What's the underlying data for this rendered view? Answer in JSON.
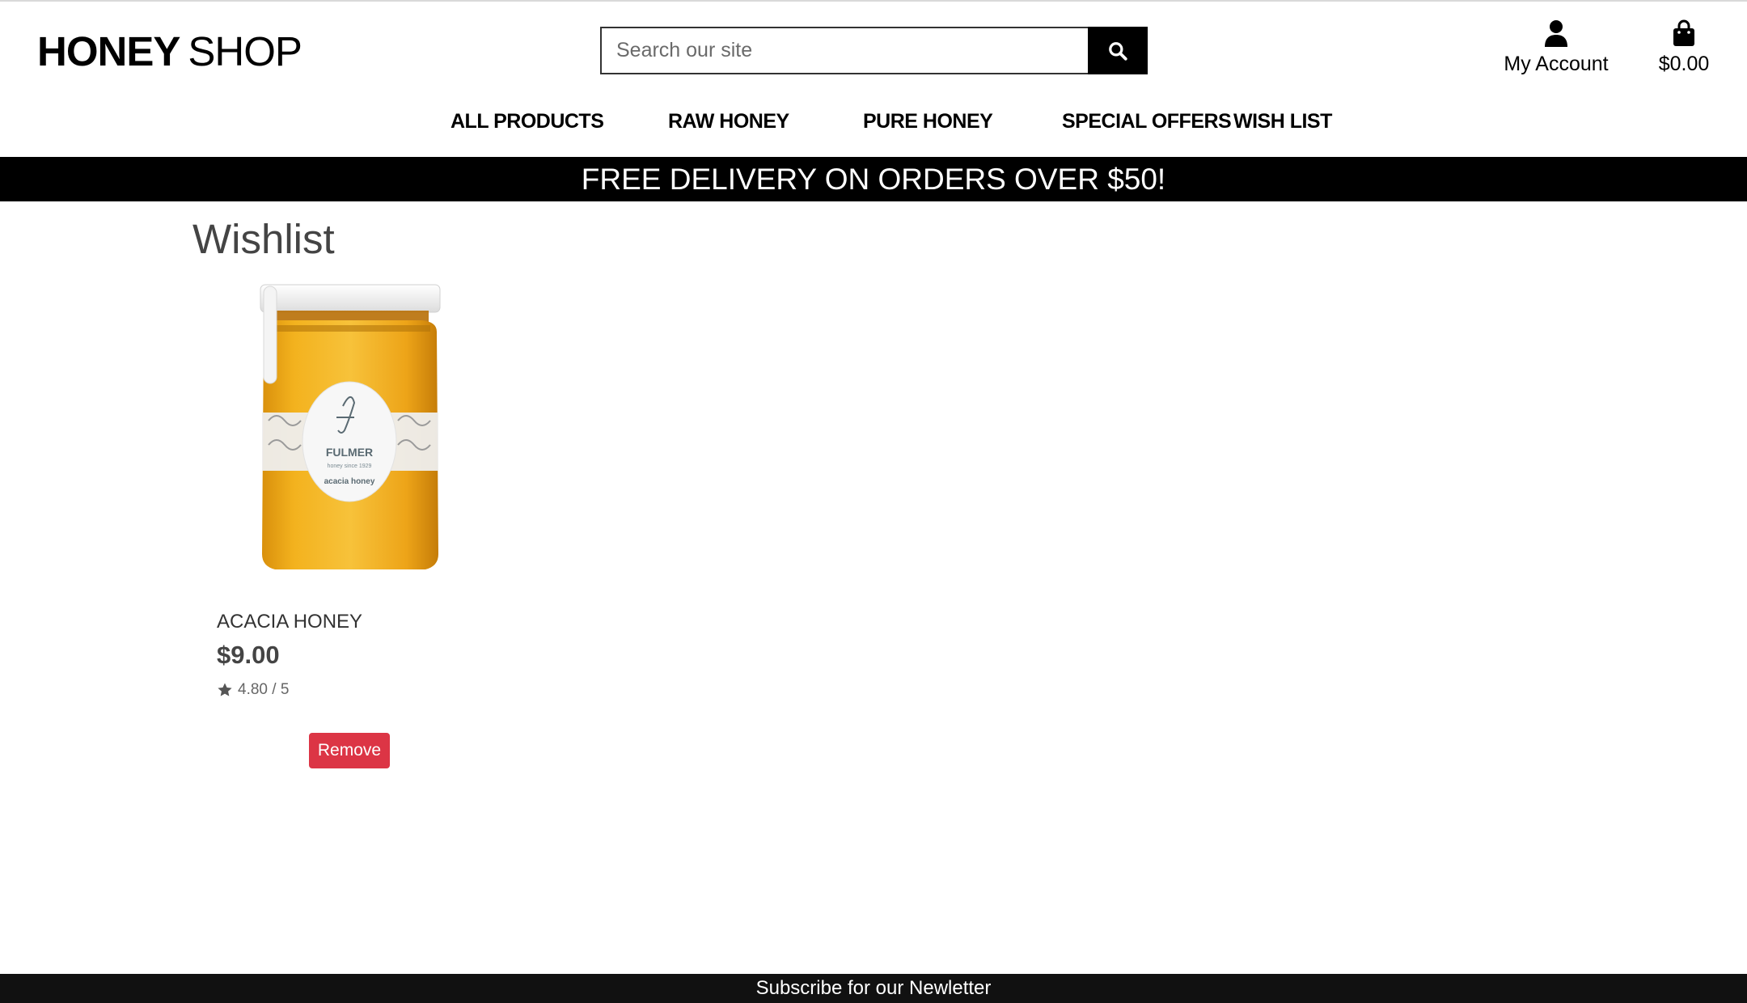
{
  "logo": {
    "bold": "HONEY",
    "light": "SHOP"
  },
  "search": {
    "placeholder": "Search our site"
  },
  "header": {
    "account_label": "My Account",
    "cart_total": "$0.00"
  },
  "nav": [
    {
      "label": "ALL PRODUCTS"
    },
    {
      "label": "RAW HONEY"
    },
    {
      "label": "PURE HONEY"
    },
    {
      "label": "SPECIAL OFFERS"
    },
    {
      "label": "WISH LIST"
    }
  ],
  "banner": "FREE DELIVERY ON ORDERS OVER $50!",
  "page": {
    "title": "Wishlist"
  },
  "wishlist": [
    {
      "name": "ACACIA HONEY",
      "price": "$9.00",
      "rating": "4.80 / 5",
      "remove_label": "Remove",
      "label_brand": "FULMER",
      "label_since": "honey since 1929",
      "label_variety": "acacia honey"
    }
  ],
  "footer": {
    "text": "Subscribe for our Newletter"
  },
  "colors": {
    "accent": "#000000",
    "danger": "#dc3545",
    "honey": "#e8a81c"
  }
}
